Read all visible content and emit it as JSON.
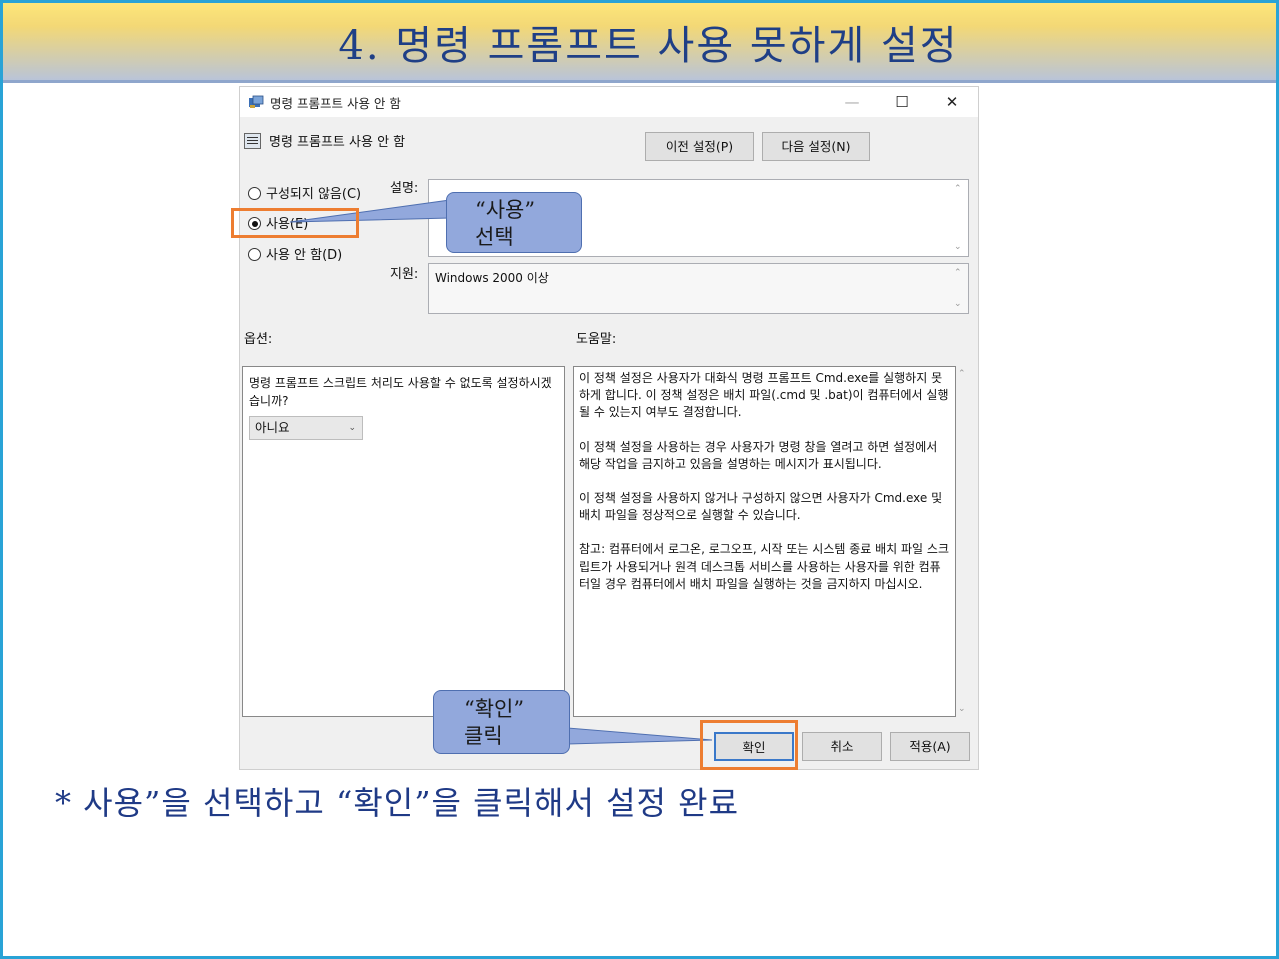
{
  "slide": {
    "title": "4. 명령 프롬프트 사용 못하게 설정",
    "bottom_note": "* 사용”을 선택하고 “확인”을 클릭해서 설정 완료"
  },
  "dialog": {
    "window_title": "명령 프롬프트 사용 안 함",
    "policy_name": "명령 프롬프트 사용 안 함",
    "prev_button": "이전 설정(P)",
    "next_button": "다음 설정(N)",
    "radio_not_configured": "구성되지 않음(C)",
    "radio_enabled": "사용(E)",
    "radio_disabled": "사용 안 함(D)",
    "description_label": "설명:",
    "supported_label": "지원:",
    "supported_value": "Windows 2000 이상",
    "options_label": "옵션:",
    "help_label": "도움말:",
    "option_question": "명령 프롬프트 스크립트 처리도 사용할 수 없도록 설정하시겠습니까?",
    "option_value": "아니요",
    "help_paragraphs": [
      "이 정책 설정은 사용자가 대화식 명령 프롬프트 Cmd.exe를 실행하지 못하게 합니다.  이 정책 설정은 배치 파일(.cmd 및 .bat)이 컴퓨터에서 실행될 수 있는지 여부도 결정합니다.",
      "이 정책 설정을 사용하는 경우 사용자가 명령 창을 열려고 하면 설정에서 해당 작업을 금지하고 있음을 설명하는 메시지가 표시됩니다.",
      "이 정책 설정을 사용하지 않거나 구성하지 않으면 사용자가 Cmd.exe 및 배치 파일을 정상적으로 실행할 수 있습니다.",
      "참고: 컴퓨터에서 로그온, 로그오프, 시작 또는 시스템 종료 배치 파일 스크립트가 사용되거나 원격 데스크톱 서비스를 사용하는 사용자를 위한 컴퓨터일 경우 컴퓨터에서 배치 파일을 실행하는 것을 금지하지 마십시오."
    ],
    "ok_button": "확인",
    "cancel_button": "취소",
    "apply_button": "적용(A)",
    "win_min": "—",
    "win_max": "☐",
    "win_close": "✕"
  },
  "callouts": {
    "use_line1": "“사용”",
    "use_line2": "선택",
    "ok_line1": "“확인”",
    "ok_line2": "클릭"
  },
  "colors": {
    "highlight": "#ed7d31",
    "callout": "#92a8dc",
    "title_text": "#1f3f86"
  }
}
